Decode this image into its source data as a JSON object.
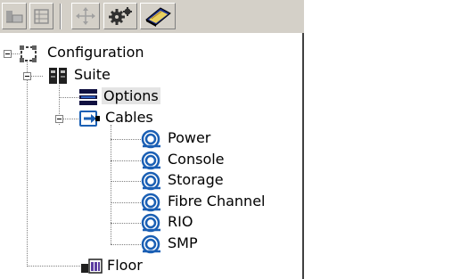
{
  "toolbar": {
    "buttons": [
      {
        "name": "layout-view-icon",
        "pressed": false
      },
      {
        "name": "panel-view-icon",
        "pressed": false
      },
      {
        "name": "connect-icon",
        "pressed": false
      },
      {
        "name": "gears-icon",
        "pressed": false
      },
      {
        "name": "book-icon",
        "pressed": false
      }
    ]
  },
  "tree": {
    "root": {
      "label": "Configuration",
      "icon": "configuration-icon",
      "expanded": true,
      "children": {
        "suite": {
          "label": "Suite",
          "icon": "suite-icon",
          "expanded": true,
          "children": {
            "options": {
              "label": "Options",
              "icon": "options-icon",
              "selected": true
            },
            "cables": {
              "label": "Cables",
              "icon": "cables-icon",
              "expanded": true,
              "children": [
                {
                  "label": "Power",
                  "icon": "cable-coil-icon"
                },
                {
                  "label": "Console",
                  "icon": "cable-coil-icon"
                },
                {
                  "label": "Storage",
                  "icon": "cable-coil-icon"
                },
                {
                  "label": "Fibre Channel",
                  "icon": "cable-coil-icon"
                },
                {
                  "label": "RIO",
                  "icon": "cable-coil-icon"
                },
                {
                  "label": "SMP",
                  "icon": "cable-coil-icon"
                }
              ]
            }
          }
        },
        "floor": {
          "label": "Floor",
          "icon": "floor-icon"
        }
      }
    }
  },
  "colors": {
    "toolbar_bg": "#d4d0c8",
    "selection_bg": "#e4e4e4",
    "cable_blue": "#1a5fb4"
  }
}
